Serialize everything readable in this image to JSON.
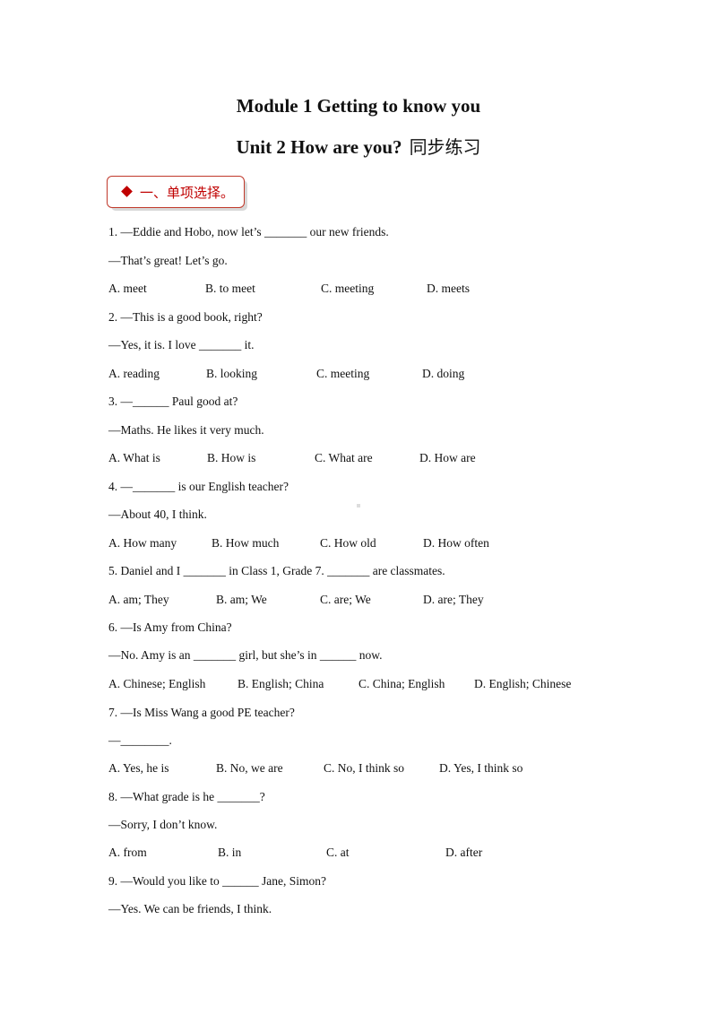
{
  "header": {
    "title_line1": "Module 1 Getting to know you",
    "title_line2_en": "Unit 2 How are you?",
    "title_line2_cn": "同步练习"
  },
  "section": {
    "icon": "diamond-icon",
    "label": "一、单项选择。",
    "accent_color": "#c00000"
  },
  "questions": [
    {
      "lines": [
        "1. —Eddie and Hobo, now let’s _______ our new friends.",
        "—That’s great! Let’s go."
      ],
      "options": [
        "A. meet",
        "B. to meet",
        "C. meeting",
        "D. meets"
      ]
    },
    {
      "lines": [
        "2. —This is a good book, right?",
        "—Yes, it is. I love _______ it."
      ],
      "options": [
        "A. reading",
        "B. looking",
        "C. meeting",
        "D. doing"
      ]
    },
    {
      "lines": [
        "3. —______ Paul good at?",
        "—Maths. He likes it very much."
      ],
      "options": [
        "A. What is",
        "B. How is",
        "C. What are",
        "D. How are"
      ]
    },
    {
      "lines": [
        "4. —_______ is our English teacher?",
        "—About 40, I think."
      ],
      "options": [
        "A. How many",
        "B. How much",
        "C. How old",
        "D. How often"
      ]
    },
    {
      "lines": [
        "5. Daniel and I _______ in Class 1, Grade 7. _______ are classmates."
      ],
      "options": [
        "A. am; They",
        "B. am; We",
        "C. are; We",
        "D. are; They"
      ]
    },
    {
      "lines": [
        "6. —Is Amy from China?",
        "—No. Amy is an _______ girl, but she’s in ______ now."
      ],
      "options": [
        "A. Chinese; English",
        "B. English; China",
        "C. China; English",
        "D. English; Chinese"
      ]
    },
    {
      "lines": [
        "7. —Is Miss Wang a good PE teacher?",
        "—________."
      ],
      "options": [
        "A. Yes, he is",
        "B. No, we are",
        "C. No, I think so",
        "D. Yes, I think so"
      ]
    },
    {
      "lines": [
        "8. —What grade is he _______?",
        "—Sorry, I don’t know."
      ],
      "options": [
        "A. from",
        "B. in",
        "C. at",
        "D. after"
      ]
    },
    {
      "lines": [
        "9. —Would you like to ______ Jane, Simon?",
        "—Yes. We can be friends, I think."
      ],
      "options": []
    }
  ]
}
